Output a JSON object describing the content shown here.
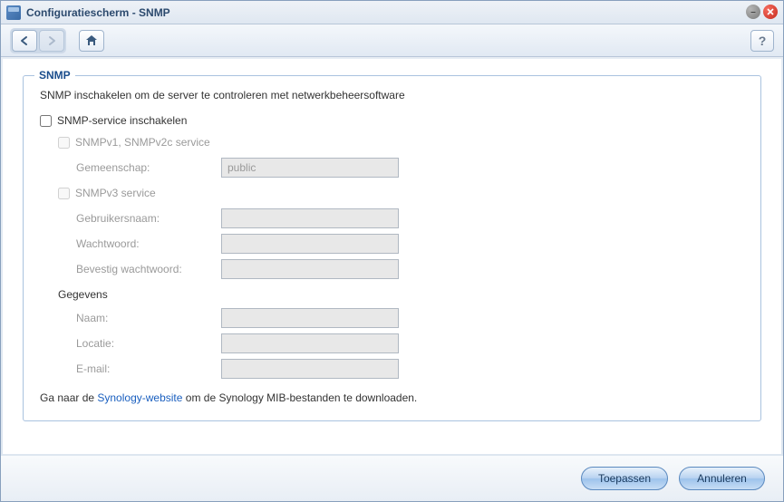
{
  "window": {
    "title": "Configuratiescherm - SNMP"
  },
  "fieldset": {
    "legend": "SNMP",
    "description": "SNMP inschakelen om de server te controleren met netwerkbeheersoftware"
  },
  "form": {
    "enable_service_label": "SNMP-service inschakelen",
    "v1v2c_label": "SNMPv1, SNMPv2c service",
    "community_label": "Gemeenschap:",
    "community_value": "public",
    "v3_label": "SNMPv3 service",
    "username_label": "Gebruikersnaam:",
    "username_value": "",
    "password_label": "Wachtwoord:",
    "password_value": "",
    "confirm_password_label": "Bevestig wachtwoord:",
    "confirm_password_value": "",
    "data_section_label": "Gegevens",
    "name_label": "Naam:",
    "name_value": "",
    "location_label": "Locatie:",
    "location_value": "",
    "email_label": "E-mail:",
    "email_value": ""
  },
  "mib": {
    "prefix": "Ga naar de ",
    "link_text": "Synology-website",
    "suffix": " om de Synology MIB-bestanden te downloaden."
  },
  "footer": {
    "apply_label": "Toepassen",
    "cancel_label": "Annuleren"
  }
}
